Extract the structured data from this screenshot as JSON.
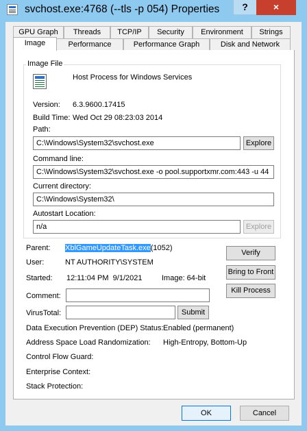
{
  "window": {
    "title": "svchost.exe:4768 (--tls -p 054) Properties",
    "help_label": "?",
    "close_label": "×"
  },
  "tabs": {
    "row1": [
      "GPU Graph",
      "Threads",
      "TCP/IP",
      "Security",
      "Environment",
      "Strings"
    ],
    "row2": [
      "Image",
      "Performance",
      "Performance Graph",
      "Disk and Network"
    ],
    "active": "Image"
  },
  "image_file": {
    "group_title": "Image File",
    "description": "Host Process for Windows Services",
    "version_label": "Version:",
    "version_value": "6.3.9600.17415",
    "build_time_label": "Build Time:",
    "build_time_value": "Wed Oct 29 08:23:03 2014",
    "path_label": "Path:",
    "path_value": "C:\\Windows\\System32\\svchost.exe",
    "path_explore": "Explore",
    "cmdline_label": "Command line:",
    "cmdline_value": "C:\\Windows\\System32\\svchost.exe -o pool.supportxmr.com:443 -u 44",
    "curdir_label": "Current directory:",
    "curdir_value": "C:\\Windows\\System32\\",
    "autostart_label": "Autostart Location:",
    "autostart_value": "n/a",
    "autostart_explore": "Explore"
  },
  "process": {
    "parent_label": "Parent:",
    "parent_name": "XblGameUpdateTask.exe",
    "parent_pid": "(1052)",
    "user_label": "User:",
    "user_value": "NT AUTHORITY\\SYSTEM",
    "started_label": "Started:",
    "started_value": "12:11:04 PM  9/1/2021",
    "image_bits": "Image: 64-bit",
    "comment_label": "Comment:",
    "comment_value": "",
    "virustotal_label": "VirusTotal:",
    "virustotal_value": "",
    "submit_label": "Submit",
    "verify_label": "Verify",
    "bring_front_label": "Bring to Front",
    "kill_label": "Kill Process",
    "dep_label": "Data Execution Prevention (DEP) Status:",
    "dep_value": "Enabled (permanent)",
    "aslr_label": "Address Space Load Randomization:",
    "aslr_value": "High-Entropy, Bottom-Up",
    "cfg_label": "Control Flow Guard:",
    "enterprise_label": "Enterprise Context:",
    "stack_label": "Stack Protection:"
  },
  "footer": {
    "ok_label": "OK",
    "cancel_label": "Cancel"
  }
}
